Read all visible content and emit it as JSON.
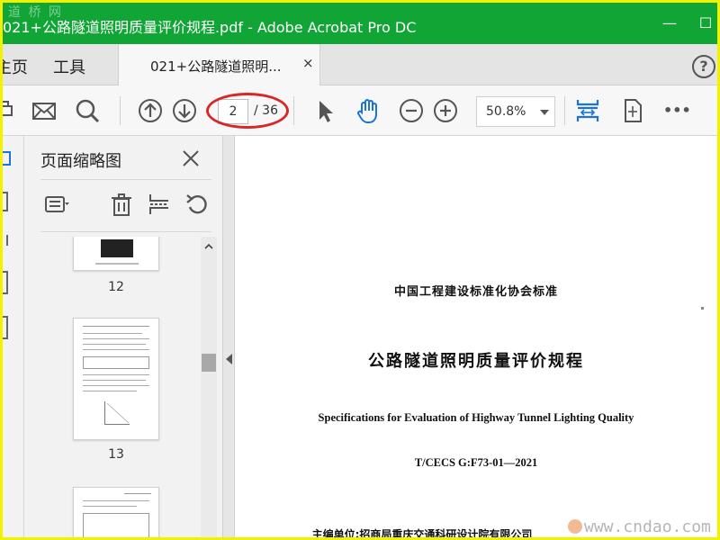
{
  "window": {
    "title": "021+公路隧道照明质量评价规程.pdf - Adobe Acrobat Pro DC",
    "watermark_top": "道 桥 网",
    "minimize_label": "—",
    "maximize_label": "☐"
  },
  "menu": {
    "items": [
      {
        "label": "主页"
      },
      {
        "label": "工具"
      }
    ],
    "doc_tab_label": "021+公路隧道照明...",
    "doc_tab_close": "×",
    "help_label": "?"
  },
  "toolbar": {
    "current_page": "2",
    "total_pages": "/ 36",
    "zoom": "50.8%",
    "more_label": "•••",
    "page_number_highlighted": true
  },
  "thumbnails_panel": {
    "title": "页面缩略图",
    "pages": [
      {
        "label": "12"
      },
      {
        "label": "13"
      },
      {
        "label": ""
      }
    ]
  },
  "document": {
    "org_line": "中国工程建设标准化协会标准",
    "title_cn": "公路隧道照明质量评价规程",
    "title_en": "Specifications for Evaluation of Highway Tunnel Lighting Quality",
    "code": "T/CECS G:F73-01—2021",
    "editor": "主编单位:招商局重庆交通科研设计院有限公司"
  },
  "watermark_bottom": "www.cndao.com",
  "colors": {
    "title_bar": "#11a536",
    "highlight_ellipse": "#d62828",
    "active_tool": "#1a73d9",
    "border_frame": "#f2f200"
  }
}
